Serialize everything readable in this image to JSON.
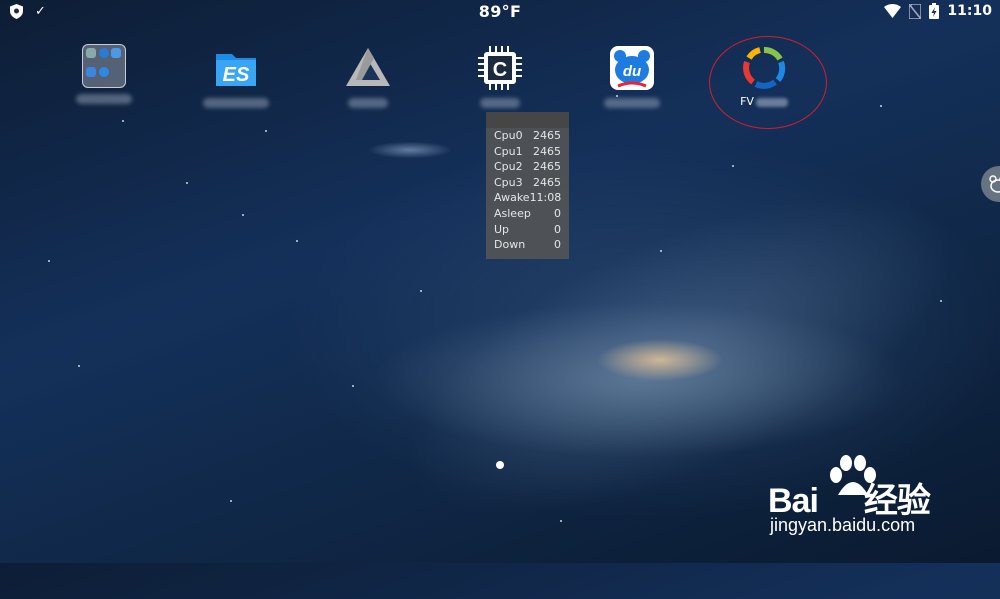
{
  "status_bar": {
    "temperature": "89°F",
    "time": "11:10",
    "left_icons": [
      "shield-icon",
      "check-icon"
    ],
    "right_icons": [
      "wifi-icon",
      "no-sim-icon",
      "battery-charging-icon"
    ]
  },
  "home": {
    "apps": [
      {
        "id": "folder",
        "label": "",
        "icon": "folder-icon"
      },
      {
        "id": "es-file",
        "label": "",
        "icon": "es-file-explorer-icon"
      },
      {
        "id": "triangle-app",
        "label": "",
        "icon": "penrose-triangle-icon"
      },
      {
        "id": "cpu-app",
        "label": "",
        "icon": "cpu-chip-icon"
      },
      {
        "id": "du-app",
        "label": "",
        "icon": "du-bear-icon"
      },
      {
        "id": "fv-app",
        "label": "FV",
        "icon": "ring-gauge-icon"
      }
    ],
    "cpu_widget": {
      "rows": [
        {
          "label": "Cpu0",
          "value": "2465"
        },
        {
          "label": "Cpu1",
          "value": "2465"
        },
        {
          "label": "Cpu2",
          "value": "2465"
        },
        {
          "label": "Cpu3",
          "value": "2465"
        },
        {
          "label": "Awake",
          "value": "11:08"
        },
        {
          "label": "Asleep",
          "value": "0"
        },
        {
          "label": "Up",
          "value": "0"
        },
        {
          "label": "Down",
          "value": "0"
        }
      ]
    },
    "page_indicator": {
      "pages": 1,
      "current": 1
    }
  },
  "watermark": {
    "brand_prefix": "Bai",
    "brand_suffix": "经验",
    "site": "jingyan.baidu.com"
  },
  "colors": {
    "highlight": "#d0202a"
  }
}
